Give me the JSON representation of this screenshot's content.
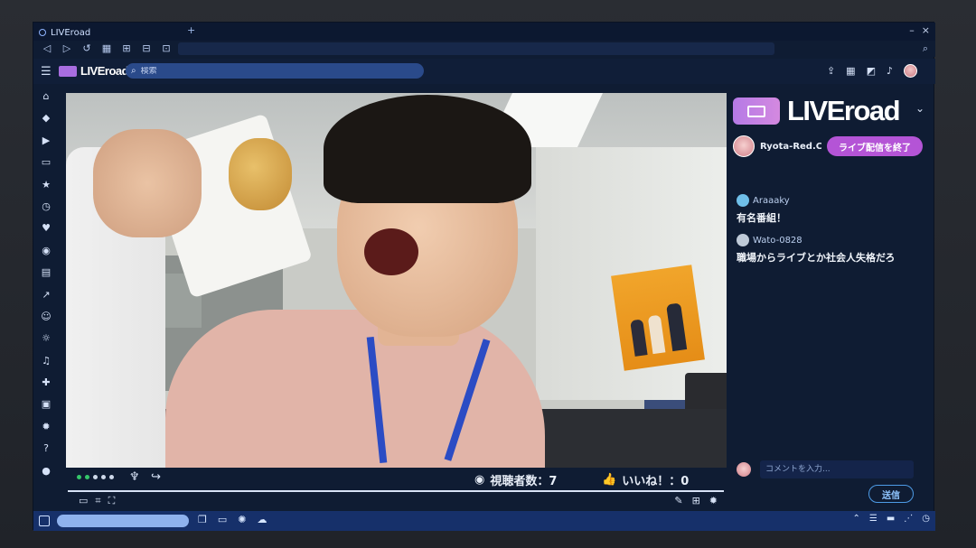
{
  "window": {
    "tab_title": "LIVEroad",
    "new_tab": "+",
    "controls": [
      "–",
      "×"
    ]
  },
  "nav": {
    "icons": [
      "back-icon",
      "forward-icon",
      "reload-icon",
      "grid-icon",
      "add-icon",
      "minus-icon",
      "zoom-icon"
    ]
  },
  "header": {
    "logo": "LIVEroad",
    "search_placeholder": "検索",
    "right_icons": [
      "upload-icon",
      "apps-icon",
      "gallery-icon",
      "bell-icon",
      "avatar"
    ]
  },
  "sidebar": {
    "icons": [
      "home-icon",
      "game-icon",
      "play-icon",
      "folder-icon",
      "star-icon",
      "clock-icon",
      "heart-icon",
      "ufo-icon",
      "calendar-icon",
      "trending-icon",
      "user-icon",
      "sun-icon",
      "music-icon",
      "controller-icon",
      "card-icon",
      "settings-icon",
      "help-icon",
      "chat-icon"
    ]
  },
  "video": {
    "viewers_label": "視聴者数：7",
    "likes_label": "いいね！：0",
    "bottom_left_icons": [
      "screen-icon",
      "crop-icon",
      "fullscreen-icon"
    ],
    "bottom_right_icons": [
      "edit-icon",
      "add-icon",
      "settings-icon"
    ]
  },
  "panel": {
    "brand": "LIVEroad",
    "user_name": "Ryota-Red.C.",
    "end_button": "ライブ配信を終了",
    "comments": [
      {
        "user": "Araaaky",
        "message": "有名番組！",
        "color": "#6fbfe9"
      },
      {
        "user": "Wato-0828",
        "message": "職場からライブとか社会人失格だろ",
        "color": "#bfcad8"
      }
    ],
    "comment_placeholder": "コメントを入力...",
    "send_button": "送信"
  },
  "colors": {
    "accent_purple": "#b454d6",
    "send_blue": "#4d9be6",
    "live_green": "#35c76a"
  }
}
